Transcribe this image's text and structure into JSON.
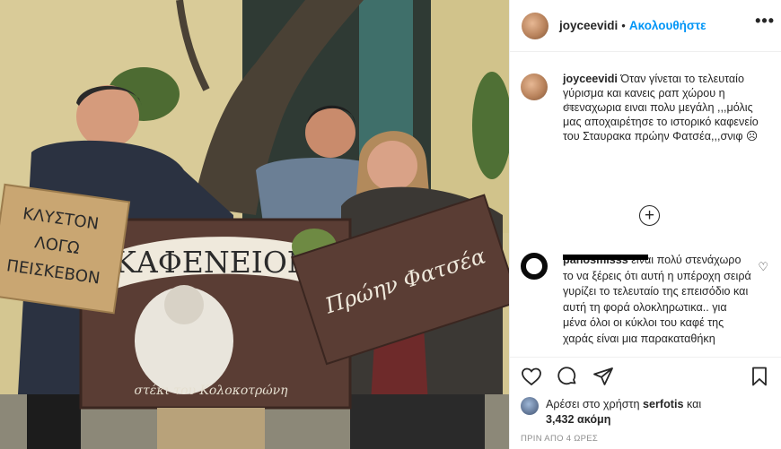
{
  "post": {
    "username": "joyceevidi",
    "separator": "•",
    "follow_label": "Ακολουθήστε",
    "more_icon": "more-options-icon",
    "more_glyph": "•••"
  },
  "photo": {
    "sign_kafeneion": "ΚΑΦΕΝΕΙΟΝ",
    "sign_subtitle": "στέκι του Κολοκοτρώνη",
    "sign_proin": "Πρώην Φατσέα",
    "sign_left_line1": "ΚΛΥΣΤΟΝ",
    "sign_left_line2": "ΛΟΓΩ",
    "sign_left_line3": "ΠΕΙΣΚΕΒΟΝ"
  },
  "caption": {
    "username": "joyceevidi",
    "text": "Όταν γίνεται το τελευταίο γύρισμα και κανεις ραπ χώρου η στεναχωρια ειναι πολυ μεγάλη ,,,μόλις μας αποχαιρέτησε το ιστορικό καφενείο του Σταυρακα πρώην Φατσέα,,,σνιφ ☹",
    "age": "4ω"
  },
  "load_more_glyph": "+",
  "comment": {
    "username": "panosmisss",
    "text": "είναι πολύ στενάχωρο το να ξέρεις ότι αυτή η υπέροχη σειρά γυρίζει το τελευταίο της επεισόδιο και αυτή τη φορά ολοκληρωτικα.. για μένα όλοι οι κύκλοι του καφέ της χαράς είναι μια παρακαταθήκη",
    "heart_glyph": "♡"
  },
  "likes": {
    "prefix": "Αρέσει στο χρήστη ",
    "user": "serfotis",
    "middle": " και",
    "count": "3,432 ακόμη"
  },
  "timestamp": "ΠΡΙΝ ΑΠΟ 4 ΩΡΕΣ",
  "colors": {
    "accent": "#0095f6",
    "text": "#262626",
    "muted": "#8e8e8e",
    "divider": "#efefef"
  }
}
